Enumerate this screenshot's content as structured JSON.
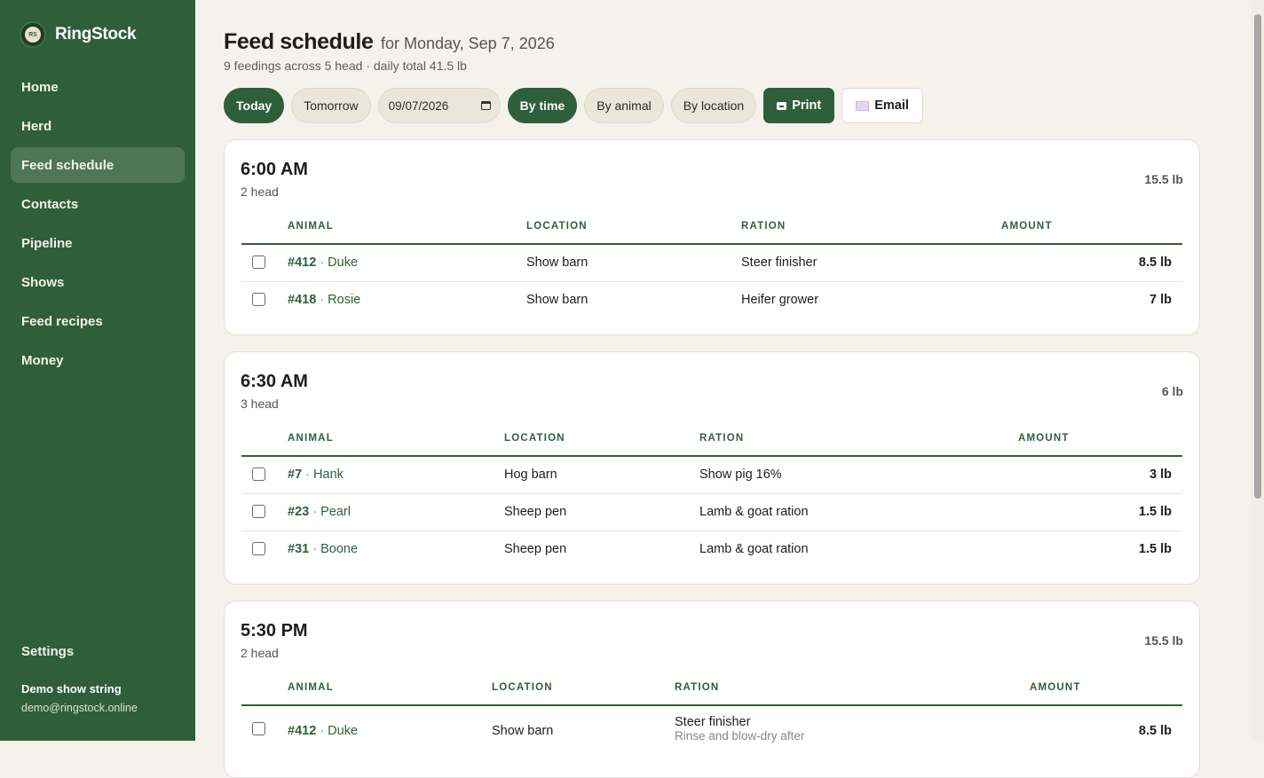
{
  "brand": {
    "name": "RingStock",
    "logo_text": "RS"
  },
  "nav": {
    "items": [
      "Home",
      "Herd",
      "Feed schedule",
      "Contacts",
      "Pipeline",
      "Shows",
      "Feed recipes",
      "Money"
    ],
    "active": "Feed schedule",
    "settings": "Settings"
  },
  "user": {
    "name": "Demo show string",
    "email": "demo@ringstock.online"
  },
  "header": {
    "title": "Feed schedule",
    "date_label": "for Monday, Sep 7, 2026",
    "subtitle": "9 feedings across 5 head · daily total 41.5 lb"
  },
  "toolbar": {
    "today": "Today",
    "tomorrow": "Tomorrow",
    "date_value": "09/07/2026",
    "by_time": "By time",
    "by_animal": "By animal",
    "by_location": "By location",
    "print": "Print",
    "email": "Email"
  },
  "columns": {
    "animal": "ANIMAL",
    "location": "LOCATION",
    "ration": "RATION",
    "amount": "AMOUNT"
  },
  "groups": [
    {
      "time": "6:00 AM",
      "count": "2 head",
      "total": "15.5 lb",
      "rows": [
        {
          "tag": "#412",
          "name": "Duke",
          "location": "Show barn",
          "ration": "Steer finisher",
          "amount": "8.5 lb"
        },
        {
          "tag": "#418",
          "name": "Rosie",
          "location": "Show barn",
          "ration": "Heifer grower",
          "amount": "7 lb"
        }
      ]
    },
    {
      "time": "6:30 AM",
      "count": "3 head",
      "total": "6 lb",
      "rows": [
        {
          "tag": "#7",
          "name": "Hank",
          "location": "Hog barn",
          "ration": "Show pig 16%",
          "amount": "3 lb"
        },
        {
          "tag": "#23",
          "name": "Pearl",
          "location": "Sheep pen",
          "ration": "Lamb & goat ration",
          "amount": "1.5 lb"
        },
        {
          "tag": "#31",
          "name": "Boone",
          "location": "Sheep pen",
          "ration": "Lamb & goat ration",
          "amount": "1.5 lb"
        }
      ]
    },
    {
      "time": "5:30 PM",
      "count": "2 head",
      "total": "15.5 lb",
      "rows": [
        {
          "tag": "#412",
          "name": "Duke",
          "location": "Show barn",
          "ration": "Steer finisher",
          "note": "Rinse and blow-dry after",
          "amount": "8.5 lb"
        }
      ]
    }
  ]
}
